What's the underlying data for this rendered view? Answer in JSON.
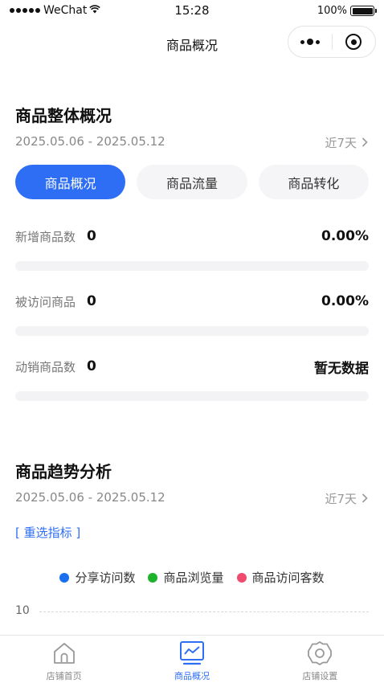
{
  "status_bar": {
    "carrier": "WeChat",
    "time": "15:28",
    "battery": "100%"
  },
  "nav": {
    "title": "商品概况"
  },
  "overview": {
    "title": "商品整体概况",
    "date_range": "2025.05.06 - 2025.05.12",
    "range_label": "近7天",
    "tabs": [
      {
        "label": "商品概况",
        "active": true
      },
      {
        "label": "商品流量",
        "active": false
      },
      {
        "label": "商品转化",
        "active": false
      }
    ],
    "metrics": [
      {
        "label": "新增商品数",
        "count": "0",
        "value": "0.00%",
        "progress": 0
      },
      {
        "label": "被访问商品",
        "count": "0",
        "value": "0.00%",
        "progress": 0
      },
      {
        "label": "动销商品数",
        "count": "0",
        "value": "暂无数据",
        "progress": 0
      }
    ]
  },
  "trend": {
    "title": "商品趋势分析",
    "date_range": "2025.05.06 - 2025.05.12",
    "range_label": "近7天",
    "reselect_label": "[ 重选指标 ]",
    "legend": [
      {
        "name": "分享访问数",
        "color": "#1a6ef0"
      },
      {
        "name": "商品浏览量",
        "color": "#1db32c"
      },
      {
        "name": "商品访问客数",
        "color": "#f04a6e"
      }
    ],
    "y_tick": "10"
  },
  "tab_bar": {
    "items": [
      {
        "label": "店铺首页",
        "icon": "home-icon",
        "active": false
      },
      {
        "label": "商品概况",
        "icon": "trend-chart-icon",
        "active": true
      },
      {
        "label": "店铺设置",
        "icon": "gear-icon",
        "active": false
      }
    ]
  },
  "colors": {
    "accent": "#2e6ef5",
    "inactive": "#888888"
  }
}
